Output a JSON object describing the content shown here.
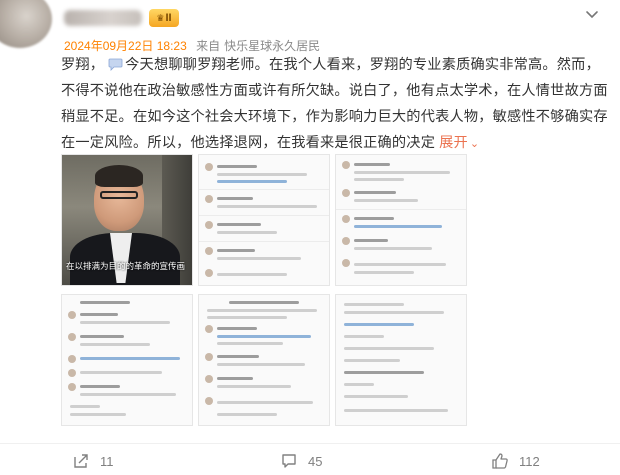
{
  "post": {
    "badge_label": "II",
    "timestamp": "2024年09月22日 18:23",
    "source_prefix": "来自",
    "source": "快乐星球永久居民",
    "mention": "罗翔，",
    "body": "今天想聊聊罗翔老师。在我个人看来，罗翔的专业素质确实非常高。然而，不得不说他在政治敏感性方面或许有所欠缺。说白了，他有点太学术，在人情世故方面稍显不足。在如今这个社会大环境下，作为影响力巨大的代表人物，敏感性不够确实存在一定风险。所以，他选择退网，在我看来是很正确的决定",
    "expand_label": "展开",
    "video_caption": "在以排满为目的的革命的宣传画"
  },
  "actions": {
    "share_count": "11",
    "comment_count": "45",
    "like_count": "112"
  },
  "icons": {
    "more": "chevron-down-icon",
    "share": "share-icon",
    "comment": "comment-icon",
    "like": "thumbs-up-icon",
    "chat": "chat-bubble-icon"
  },
  "colors": {
    "accent": "#ff8200",
    "expand": "#eb7350",
    "meta": "#8a8a8a"
  }
}
